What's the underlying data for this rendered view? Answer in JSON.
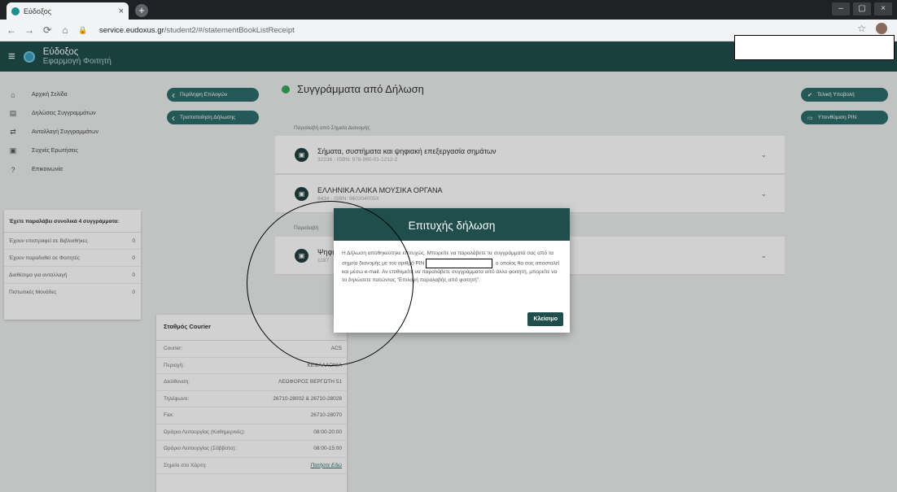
{
  "browser": {
    "tab_title": "Εύδοξος",
    "tab_close": "×",
    "new_tab": "+",
    "url_host": "service.eudoxus.gr",
    "url_path": "/student2/#/statementBookListReceipt",
    "window_controls": [
      "–",
      "▢",
      "×"
    ]
  },
  "header": {
    "title": "Εύδοξος",
    "subtitle": "Εφαρμογή Φοιτητή"
  },
  "sidebar": {
    "items": [
      {
        "label": "Αρχική Σελίδα",
        "icon": "home-icon"
      },
      {
        "label": "Δηλώσεις Συγγραμμάτων",
        "icon": "list-icon"
      },
      {
        "label": "Ανταλλαγή Συγγραμμάτων",
        "icon": "swap-icon"
      },
      {
        "label": "Συχνές Ερωτήσεις",
        "icon": "faq-icon"
      },
      {
        "label": "Επικοινωνία",
        "icon": "help-icon"
      }
    ],
    "stats": {
      "heading": "Έχετε παραλάβει συνολικά 4 συγγράμματα:",
      "rows": [
        {
          "label": "Έχουν επιστραφεί σε Βιβλιοθήκες",
          "value": "0"
        },
        {
          "label": "Έχουν παραδοθεί σε Φοιτητές",
          "value": "0"
        },
        {
          "label": "Διαθέσιμα για ανταλλαγή",
          "value": "0"
        },
        {
          "label": "Πιστωτικές Μονάδες",
          "value": "0"
        }
      ]
    }
  },
  "actions": {
    "view_selections": "Περίληψη Επιλογών",
    "modify_statement": "Τροποποίηση Δήλωσης"
  },
  "main": {
    "title": "Συγγράμματα από Δήλωση",
    "section_pickup": "Παραλαβή από Σημεία Διανομής",
    "section_student": "Παραλαβή",
    "books": [
      {
        "title": "Σήματα, συστήματα και ψηφιακή επεξεργασία σημάτων",
        "meta": "32236 - ISBN: 978-960-01-1212-2"
      },
      {
        "title": "ΕΛΛΗΝΙΚΑ ΛΑΙΚΑ ΜΟΥΣΙΚΑ ΟΡΓΑΝΑ",
        "meta": "8434 - ISBN: 960204005X"
      },
      {
        "title": "Ψηφι",
        "meta": "1187"
      }
    ]
  },
  "right_actions": {
    "final_submit": "Τελική Υποβολή",
    "pin_reminder": "Υπενθύμιση PIN"
  },
  "courier": {
    "heading": "Σταθμός Courier",
    "rows": [
      {
        "label": "Courier:",
        "value": "ACS"
      },
      {
        "label": "Περιοχή:",
        "value": "ΚΕΦΑΛΛΟΝΙΑ"
      },
      {
        "label": "Διεύθυνση:",
        "value": "ΛΕΩΦΟΡΟΣ ΒΕΡΓΩΤΗ 51"
      },
      {
        "label": "Τηλέφωνο:",
        "value": "26710-28002 & 26710-28028"
      },
      {
        "label": "Fax:",
        "value": "26710-28070"
      },
      {
        "label": "Ωράριο Λειτουργίας (Καθημερινές):",
        "value": "08:00-20:00"
      },
      {
        "label": "Ωράριο Λειτουργίας (Σάββατο):",
        "value": "08:00-15:00"
      },
      {
        "label": "Σημείο στο Χάρτη:",
        "value": "Πατήστε Εδώ"
      }
    ]
  },
  "modal": {
    "title": "Επιτυχής δήλωση",
    "body_1": "Η Δήλωση αποθηκεύτηκε επιτυχώς. Μπορείτε να παραλάβετε τα συγγράμματά σας από τα σημεία διανομής με τον αριθμό PIN",
    "body_2": ", ο οποίος θα σας αποσταλεί και μέσω e-mail. Αν επιθυμείτε να παραλάβετε συγγράμματα από άλλο φοιτητή, μπορείτε να το δηλώσετε πατώντας \"Επιλογή παραλαβής από φοιτητή\".",
    "close": "Κλείσιμο"
  }
}
